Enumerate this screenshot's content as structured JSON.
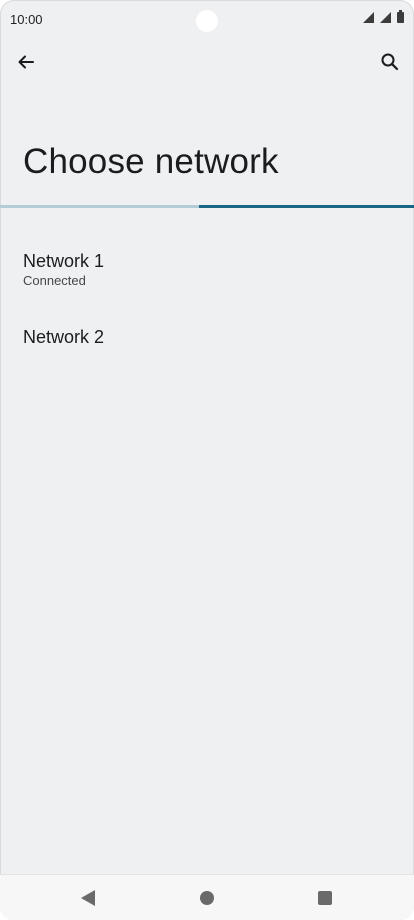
{
  "status_bar": {
    "time": "10:00",
    "icons": [
      "signal-icon",
      "signal-icon",
      "battery-icon"
    ]
  },
  "app_bar": {
    "back_icon": "arrow-back-icon",
    "search_icon": "search-icon"
  },
  "page": {
    "title": "Choose network",
    "progress_fraction": 0.52
  },
  "networks": [
    {
      "name": "Network 1",
      "status": "Connected"
    },
    {
      "name": "Network 2",
      "status": ""
    }
  ],
  "nav_bar": {
    "icons": [
      "nav-back-icon",
      "nav-home-icon",
      "nav-recents-icon"
    ]
  },
  "colors": {
    "background": "#eff0f2",
    "progress_track": "#b3cdd8",
    "progress_fill": "#1b6584",
    "text_primary": "#1b1c1e",
    "text_secondary": "#45474a"
  }
}
